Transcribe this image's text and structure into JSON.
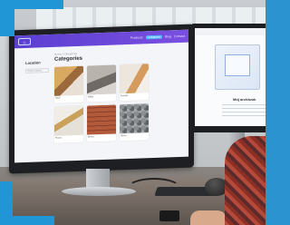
{
  "main_screen": {
    "logo_text": "◇",
    "nav": [
      "Products",
      "Solutions",
      "Blog",
      "Contact"
    ],
    "breadcrumb": "Home / Categories",
    "sidebar_title": "Location",
    "sidebar_filter": "Select country",
    "page_title": "Categories",
    "tiles": [
      {
        "caption": "Roof"
      },
      {
        "caption": "Walls"
      },
      {
        "caption": "Facade"
      },
      {
        "caption": "Floors"
      },
      {
        "caption": "Bricks"
      },
      {
        "caption": "Stone"
      }
    ]
  },
  "second_screen": {
    "title": "Mój archiwok"
  }
}
